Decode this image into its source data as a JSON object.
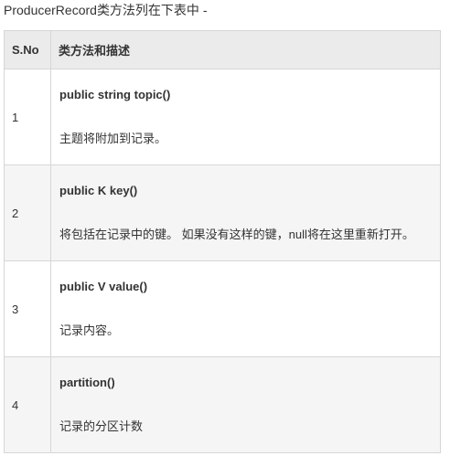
{
  "intro_text": "ProducerRecord类方法列在下表中 -",
  "table": {
    "headers": {
      "sno": "S.No",
      "method": "类方法和描述"
    },
    "rows": [
      {
        "sno": "1",
        "method": "public string topic()",
        "description": "主题将附加到记录。"
      },
      {
        "sno": "2",
        "method": "public K key()",
        "description": "将包括在记录中的键。 如果没有这样的键，null将在这里重新打开。"
      },
      {
        "sno": "3",
        "method": "public V value()",
        "description": "记录内容。"
      },
      {
        "sno": "4",
        "method": "partition()",
        "description": "记录的分区计数"
      }
    ]
  }
}
